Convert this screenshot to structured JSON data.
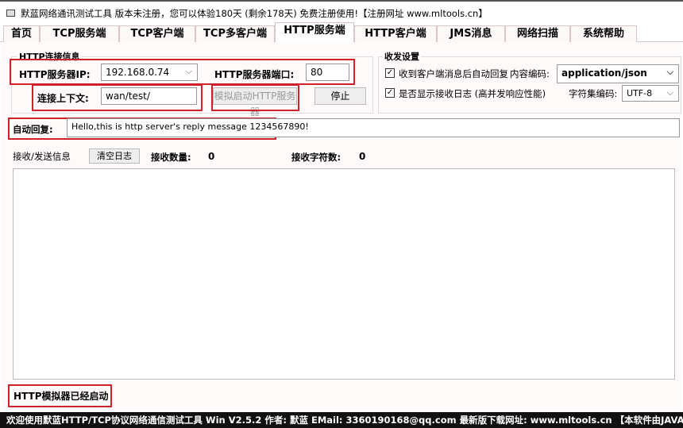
{
  "window": {
    "title": "默蓝网络通讯测试工具 版本未注册，您可以体验180天 (剩余178天) 免费注册使用!【注册网址 www.mltools.cn】"
  },
  "tabs": [
    "首页",
    "TCP服务端",
    "TCP客户端",
    "TCP多客户端",
    "HTTP服务端",
    "HTTP客户端",
    "JMS消息",
    "网络扫描",
    "系统帮助"
  ],
  "active_tab": "HTTP服务端",
  "conn": {
    "group": "HTTP连接信息",
    "ip_label": "HTTP服务器IP:",
    "ip": "192.168.0.74",
    "port_label": "HTTP服务器端口:",
    "port": "80",
    "ctx_label": "连接上下文:",
    "ctx": "wan/test/",
    "start": "模拟启动HTTP服务器",
    "stop": "停止"
  },
  "settings": {
    "group": "收发设置",
    "auto_reply": "收到客户端消息后自动回复",
    "auto_reply_checked": true,
    "content_label": "内容编码:",
    "content": "application/json",
    "show_log": "是否显示接收日志 (高并发响应性能)",
    "show_log_checked": true,
    "charset_label": "字符集编码:",
    "charset": "UTF-8"
  },
  "reply": {
    "label": "自动回复:",
    "value": "Hello,this is http server's reply message 1234567890!"
  },
  "recv": {
    "label": "接收/发送信息",
    "clear": "清空日志",
    "count_label": "接收数量:",
    "count": "0",
    "chars_label": "接收字符数:",
    "chars": "0"
  },
  "status": "HTTP模拟器已经启动",
  "footer": "欢迎使用默蓝HTTP/TCP协议网络通信测试工具 Win V2.5.2 作者: 默蓝  EMail: 3360190168@qq.com 最新版下载网址: www.mltools.cn   【本软件由JAVA语言开发  永久技术支持】"
}
